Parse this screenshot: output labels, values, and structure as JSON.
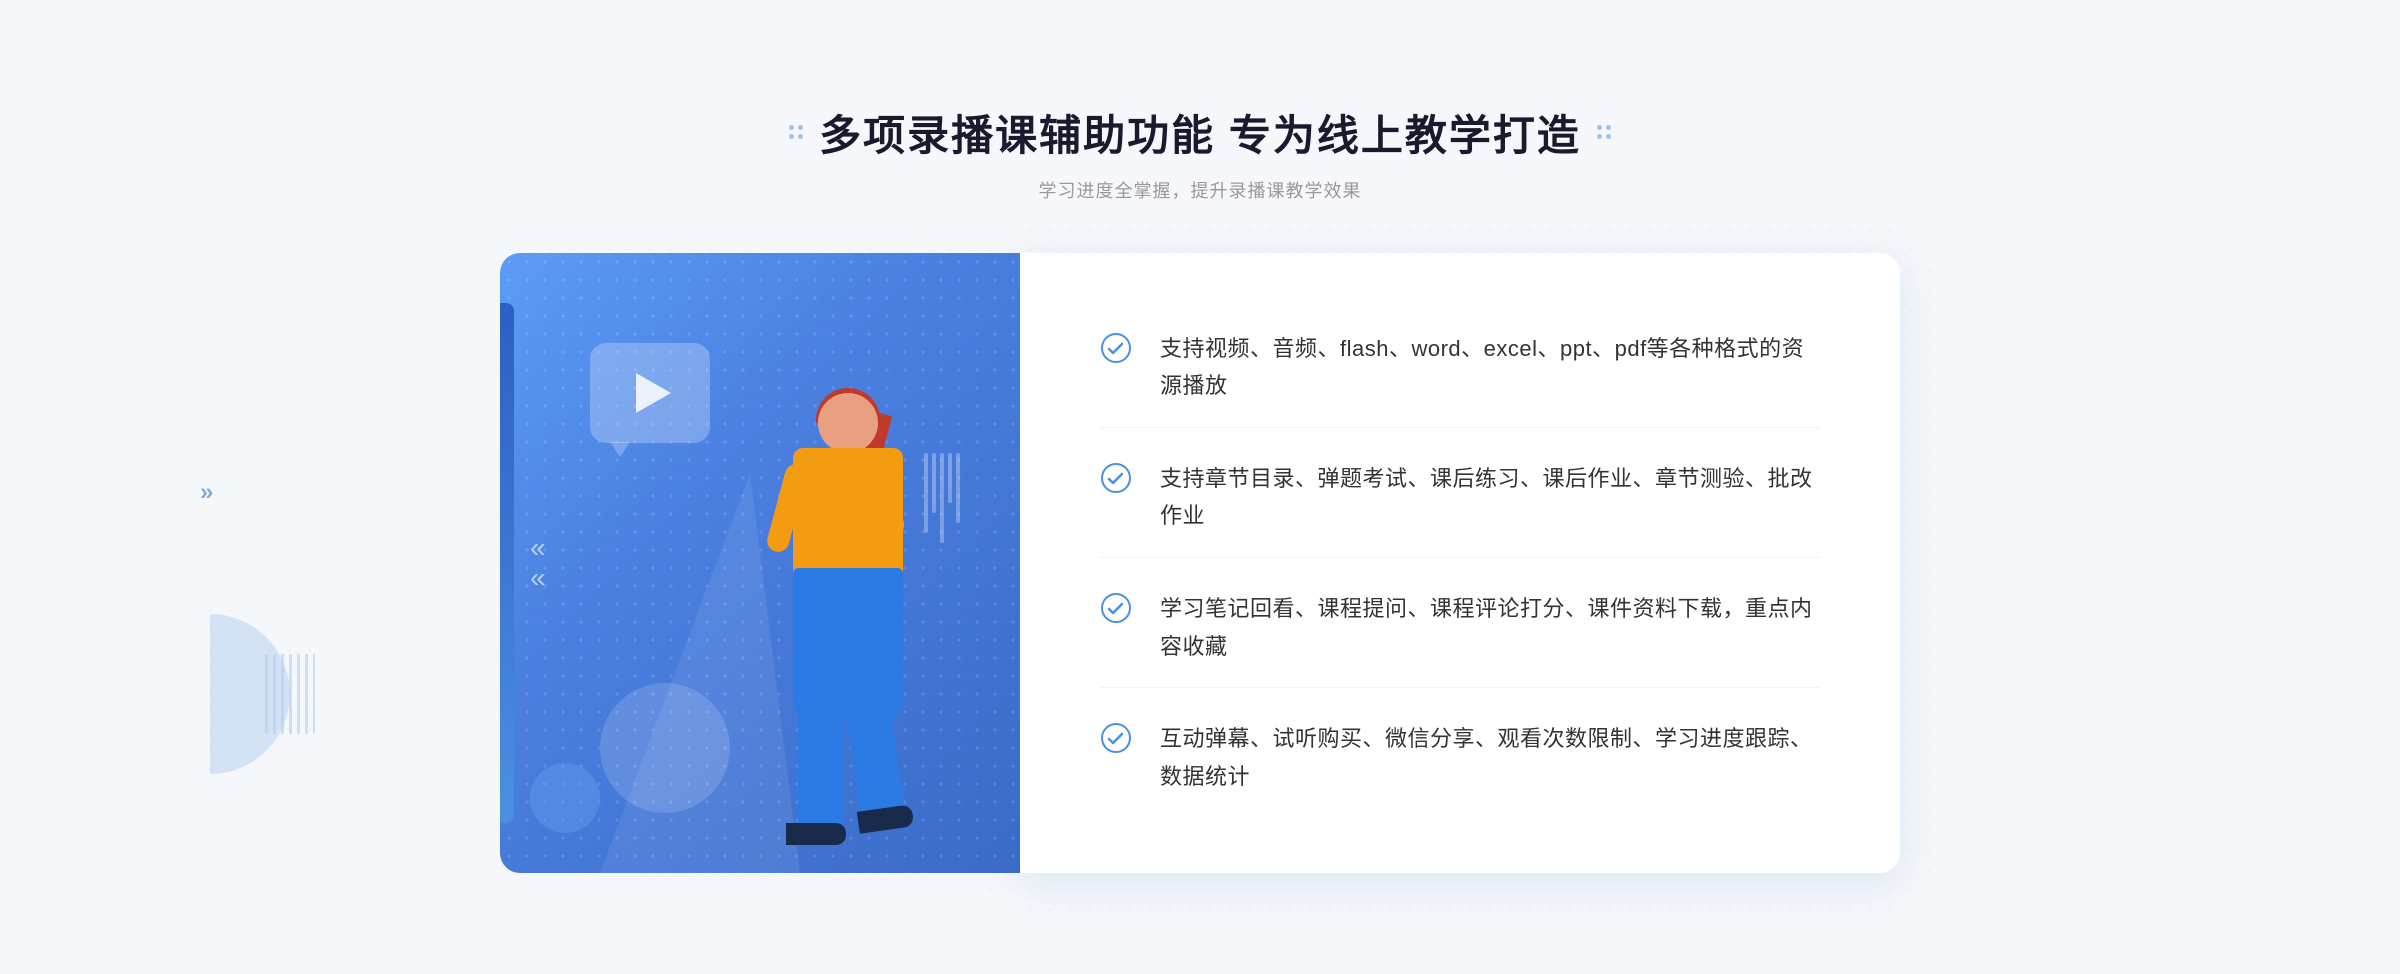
{
  "header": {
    "title": "多项录播课辅助功能 专为线上教学打造",
    "subtitle": "学习进度全掌握，提升录播课教学效果"
  },
  "features": [
    {
      "id": "feature-1",
      "text": "支持视频、音频、flash、word、excel、ppt、pdf等各种格式的资源播放"
    },
    {
      "id": "feature-2",
      "text": "支持章节目录、弹题考试、课后练习、课后作业、章节测验、批改作业"
    },
    {
      "id": "feature-3",
      "text": "学习笔记回看、课程提问、课程评论打分、课件资料下载，重点内容收藏"
    },
    {
      "id": "feature-4",
      "text": "互动弹幕、试听购买、微信分享、观看次数限制、学习进度跟踪、数据统计"
    }
  ],
  "decorative": {
    "left_arrows": "»",
    "title_dots_left": "⁞",
    "title_dots_right": "⁞"
  }
}
